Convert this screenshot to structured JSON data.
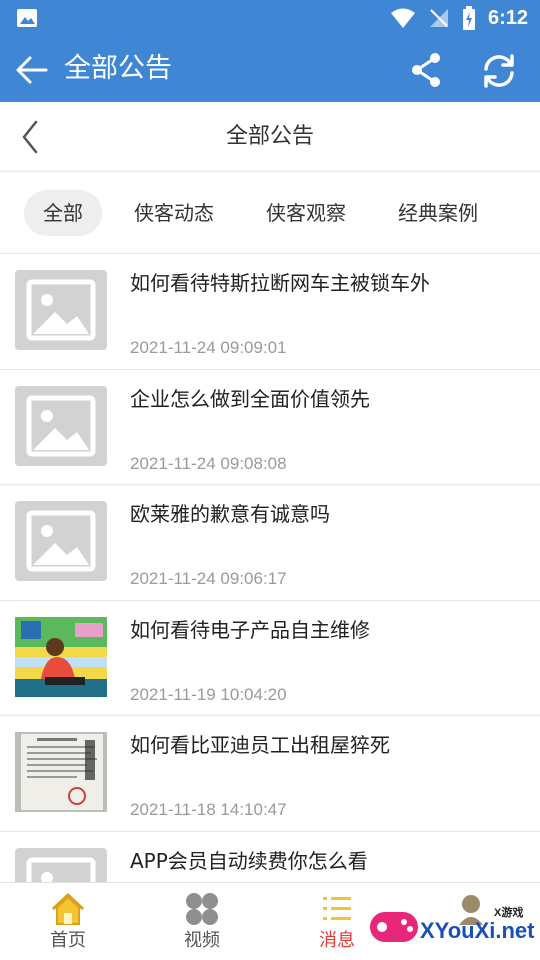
{
  "status_bar": {
    "time": "6:12"
  },
  "app_bar": {
    "title": "全部公告"
  },
  "page_header": {
    "title": "全部公告"
  },
  "tabs": [
    {
      "label": "全部",
      "active": true
    },
    {
      "label": "侠客动态",
      "active": false
    },
    {
      "label": "侠客观察",
      "active": false
    },
    {
      "label": "经典案例",
      "active": false
    }
  ],
  "articles": [
    {
      "title": "如何看待特斯拉断网车主被锁车外",
      "time": "2021-11-24 09:09:01",
      "thumb": "placeholder-image"
    },
    {
      "title": "企业怎么做到全面价值领先",
      "time": "2021-11-24 09:08:08",
      "thumb": "placeholder-image"
    },
    {
      "title": "欧莱雅的歉意有诚意吗",
      "time": "2021-11-24 09:06:17",
      "thumb": "placeholder-image"
    },
    {
      "title": "如何看待电子产品自主维修",
      "time": "2021-11-19 10:04:20",
      "thumb": "repair-illustration"
    },
    {
      "title": "如何看比亚迪员工出租屋猝死",
      "time": "2021-11-18 14:10:47",
      "thumb": "document-photo"
    },
    {
      "title": "APP会员自动续费你怎么看",
      "time": "",
      "thumb": "placeholder-image"
    }
  ],
  "bottom_nav": [
    {
      "label": "首页",
      "icon": "home-icon",
      "active": false
    },
    {
      "label": "视频",
      "icon": "video-icon",
      "active": false
    },
    {
      "label": "消息",
      "icon": "list-icon",
      "active": true
    },
    {
      "label": "",
      "icon": "profile-icon",
      "active": false
    }
  ],
  "watermark": {
    "small": "X游戏",
    "big": "XYouXi.net"
  },
  "colors": {
    "primary": "#3f86d4",
    "active_nav": "#e53935",
    "time_text": "#9a9a9a",
    "placeholder_gray": "#d2d2d2"
  }
}
